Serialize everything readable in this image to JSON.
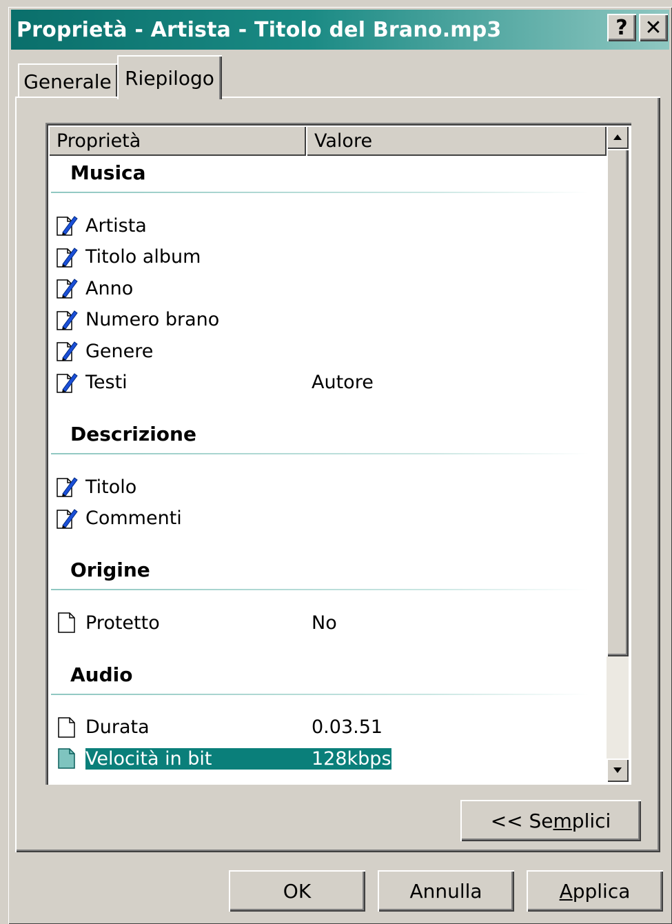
{
  "window": {
    "title": "Proprietà - Artista - Titolo del Brano.mp3",
    "help_button": "?",
    "close_button": "✕"
  },
  "tabs": [
    {
      "label": "Generale",
      "active": false
    },
    {
      "label": "Riepilogo",
      "active": true
    }
  ],
  "list": {
    "columns": [
      "Proprietà",
      "Valore"
    ],
    "groups": [
      {
        "title": "Musica",
        "rows": [
          {
            "name": "Artista",
            "value": "",
            "icon": "edit-icon"
          },
          {
            "name": "Titolo album",
            "value": "",
            "icon": "edit-icon"
          },
          {
            "name": "Anno",
            "value": "",
            "icon": "edit-icon"
          },
          {
            "name": "Numero brano",
            "value": "",
            "icon": "edit-icon"
          },
          {
            "name": "Genere",
            "value": "",
            "icon": "edit-icon"
          },
          {
            "name": "Testi",
            "value": "Autore",
            "icon": "edit-icon"
          }
        ]
      },
      {
        "title": "Descrizione",
        "rows": [
          {
            "name": "Titolo",
            "value": "",
            "icon": "edit-icon"
          },
          {
            "name": "Commenti",
            "value": "",
            "icon": "edit-icon"
          }
        ]
      },
      {
        "title": "Origine",
        "rows": [
          {
            "name": "Protetto",
            "value": "No",
            "icon": "document-icon"
          }
        ]
      },
      {
        "title": "Audio",
        "rows": [
          {
            "name": "Durata",
            "value": "0.03.51",
            "icon": "document-icon"
          },
          {
            "name": "Velocità in bit",
            "value": "128kbps",
            "icon": "document-icon",
            "selected": true
          }
        ]
      }
    ]
  },
  "buttons": {
    "simple_prefix": "<< Se",
    "simple_accel": "m",
    "simple_suffix": "plici",
    "ok": "OK",
    "cancel": "Annulla",
    "apply_accel": "A",
    "apply_suffix": "pplica"
  },
  "colors": {
    "titlebar": "#0a6f6b",
    "selection": "#0a7f7a",
    "face": "#d4d0c8"
  }
}
